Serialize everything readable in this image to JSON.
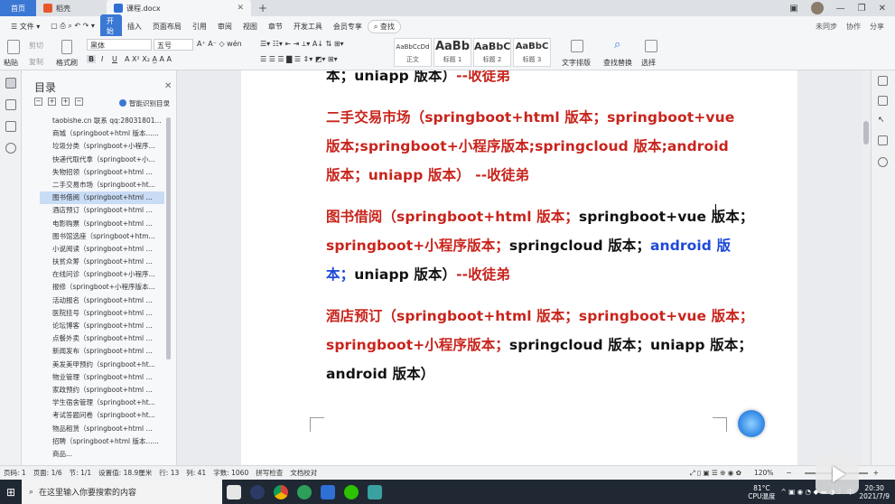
{
  "titlebar": {
    "tabs": [
      {
        "label": "首页",
        "active": false
      },
      {
        "label": "稻壳",
        "active": false
      },
      {
        "label": "课程.docx",
        "active": true
      }
    ],
    "new_tab_label": "+"
  },
  "menubar": {
    "file_label": "文件",
    "items": [
      "开始",
      "插入",
      "页面布局",
      "引用",
      "审阅",
      "视图",
      "章节",
      "开发工具",
      "会员专享"
    ],
    "search_label": "查找",
    "right_items": [
      "未同步",
      "协作",
      "分享"
    ]
  },
  "ribbon": {
    "paste_label": "粘贴",
    "cut_label": "剪切",
    "copy_label": "复制",
    "format_painter_label": "格式刷",
    "font_name": "黑体",
    "font_size": "五号",
    "styles": [
      {
        "sample": "AaBbCcDd",
        "label": "正文"
      },
      {
        "sample": "AaBb",
        "label": "标题 1"
      },
      {
        "sample": "AaBbC",
        "label": "标题 2"
      },
      {
        "sample": "AaBbC",
        "label": "标题 3"
      }
    ],
    "text_layout_label": "文字排版",
    "find_replace_label": "查找替换",
    "select_label": "选择"
  },
  "toc": {
    "title": "目录",
    "smart_label": "智能识别目录",
    "items": [
      "taobishe.cn 联系 qq:28031801...",
      "商城（springboot+html 版本......",
      "垃圾分类（springboot+小程序...",
      "快递代取代拿（springboot+小...",
      "失物招领（springboot+html ...",
      "二手交易市场（springboot+ht...",
      "图书借阅（springboot+html ...",
      "酒店预订（springboot+html ...",
      "电影购票（springboot+html ...",
      "图书馆选座（springboot+htm...",
      "小说阅读（springboot+html ...",
      "扶贫众筹（springboot+html ...",
      "在线问诊（springboot+小程序...",
      "报修（springboot+小程序版本...",
      "活动报名（springboot+html ...",
      "医院挂号（springboot+html ...",
      "论坛博客（springboot+html ...",
      "点餐外卖（springboot+html ...",
      "新闻发布（springboot+html ...",
      "美发美甲预约（springboot+ht...",
      "物业管理（springboot+html ...",
      "家政预约（springboot+html ...",
      "学生宿舍管理（springboot+ht...",
      "考试答题问卷（springboot+ht...",
      "物品租赁（springboot+html ...",
      "招聘（springboot+html 版本......",
      "商品..."
    ],
    "selected_index": 6
  },
  "document": {
    "lines": [
      [
        {
          "t": "本；uniapp 版本）",
          "c": "black"
        },
        {
          "t": "--收徒弟",
          "c": "red"
        }
      ],
      [
        {
          "t": "二手交易市场（springboot+html 版本；springboot+vue",
          "c": "red"
        }
      ],
      [
        {
          "t": "版本;springboot+小程序版本;springcloud 版本;android",
          "c": "red"
        }
      ],
      [
        {
          "t": "版本；uniapp 版本） --收徒弟",
          "c": "red"
        }
      ],
      [
        {
          "t": "图书借阅（springboot+html 版本；",
          "c": "red"
        },
        {
          "t": "springboot+vue 版本；",
          "c": "black"
        }
      ],
      [
        {
          "t": "springboot+小程序版本；",
          "c": "red"
        },
        {
          "t": "springcloud 版本；",
          "c": "black"
        },
        {
          "t": "android 版",
          "c": "blue"
        }
      ],
      [
        {
          "t": "本；",
          "c": "blue"
        },
        {
          "t": "uniapp 版本）",
          "c": "black"
        },
        {
          "t": "--收徒弟",
          "c": "red"
        }
      ],
      [
        {
          "t": "酒店预订（springboot+html 版本；springboot+vue 版本；",
          "c": "red"
        }
      ],
      [
        {
          "t": "springboot+小程序版本；",
          "c": "red"
        },
        {
          "t": "springcloud 版本；uniapp 版本；",
          "c": "black"
        }
      ],
      [
        {
          "t": "android 版本）",
          "c": "black"
        }
      ]
    ]
  },
  "statusbar": {
    "items": [
      "页码: 1",
      "页面: 1/6",
      "节: 1/1",
      "设置值: 18.9厘米",
      "行: 13",
      "列: 41",
      "字数: 1060",
      "拼写检查",
      "文档校对"
    ],
    "zoom": "120%"
  },
  "taskbar": {
    "search_placeholder": "在这里输入你要搜索的内容",
    "temperature": "81°C",
    "cpu_label": "CPU温度",
    "ime": "中",
    "time": "20:30",
    "date": "2021/7/9"
  },
  "colors": {
    "accent": "#3a78d4",
    "doc_red": "#c8241c",
    "doc_blue": "#1f48d8"
  }
}
